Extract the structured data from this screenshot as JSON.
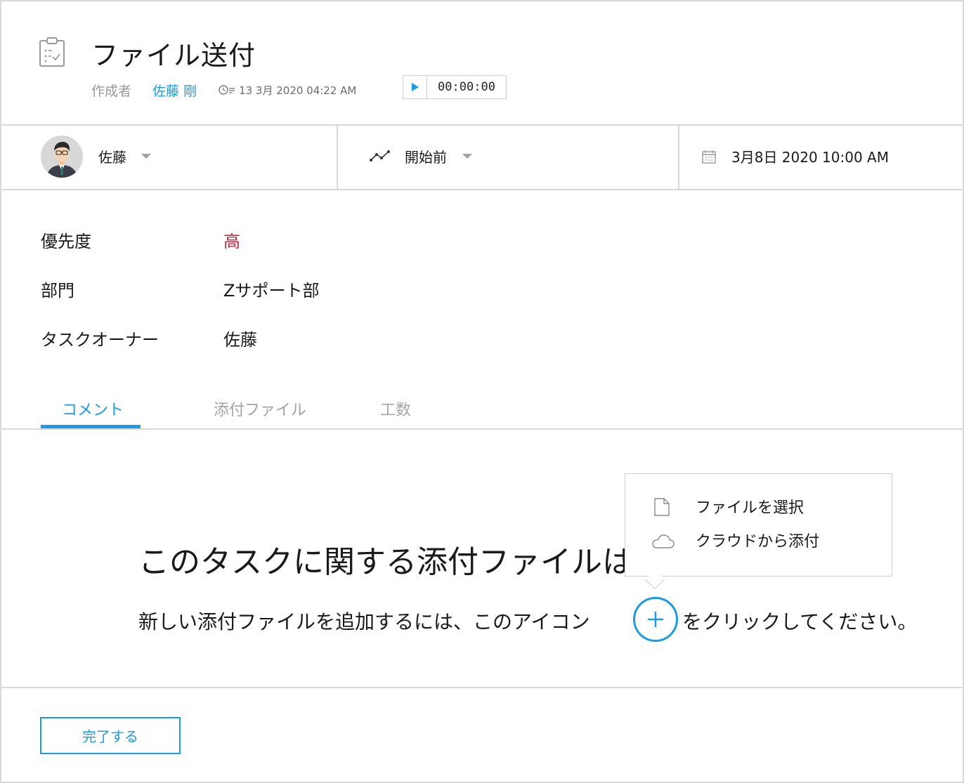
{
  "header": {
    "title": "ファイル送付",
    "author_label": "作成者",
    "author_name": "佐藤 剛",
    "created_at": "13 3月 2020 04:22 AM",
    "timer": "00:00:00"
  },
  "info_strip": {
    "owner": "佐藤",
    "status": "開始前",
    "due_date": "3月8日 2020 10:00 AM"
  },
  "properties": [
    {
      "label": "優先度",
      "value": "高"
    },
    {
      "label": "部門",
      "value": "Zサポート部"
    },
    {
      "label": "タスクオーナー",
      "value": "佐藤"
    }
  ],
  "tabs": [
    {
      "label": "コメント",
      "active": true
    },
    {
      "label": "添付ファイル",
      "active": false
    },
    {
      "label": "工数",
      "active": false
    }
  ],
  "empty_state": {
    "title": "このタスクに関する添付ファイルはありません。",
    "hint_before": "新しい添付ファイルを追加するには、このアイコン",
    "hint_after": "をクリックしてください。"
  },
  "attach_menu": {
    "items": [
      {
        "label": "ファイルを選択",
        "icon": "file-icon"
      },
      {
        "label": "クラウドから添付",
        "icon": "cloud-icon"
      }
    ]
  },
  "footer": {
    "complete_label": "完了する"
  },
  "colors": {
    "accent": "#1a9be6",
    "priority_high": "#c8263c",
    "border": "#d9d9d9"
  }
}
